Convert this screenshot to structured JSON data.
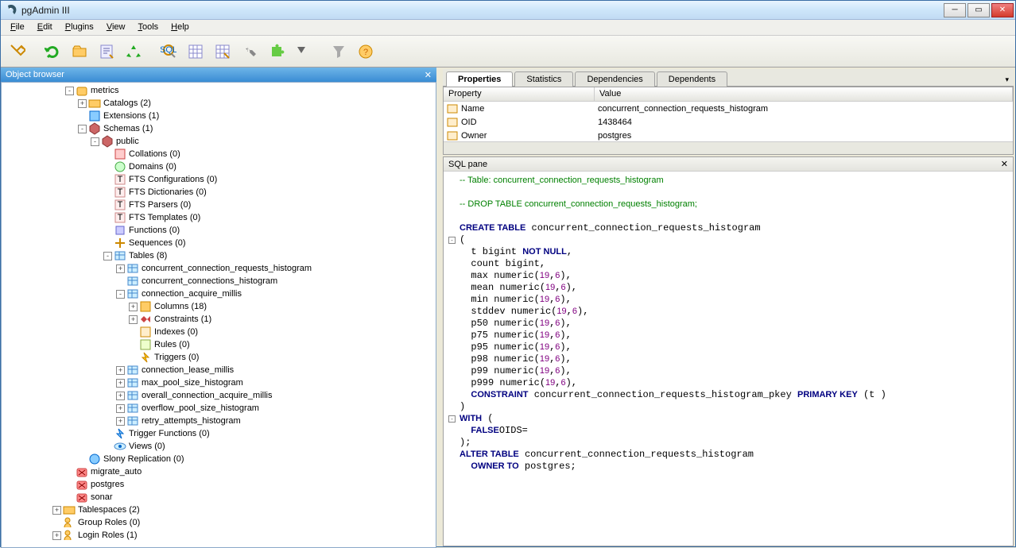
{
  "window": {
    "title": "pgAdmin III"
  },
  "menus": [
    "File",
    "Edit",
    "Plugins",
    "View",
    "Tools",
    "Help"
  ],
  "toolbar_icons": [
    "plug",
    "refresh",
    "open",
    "script",
    "recycle",
    "sql",
    "grid",
    "grid-filter",
    "wrench",
    "puzzle",
    "dropdown",
    "funnel",
    "help"
  ],
  "object_browser": {
    "title": "Object browser",
    "nodes": [
      {
        "indent": 5,
        "exp": "-",
        "icon": "db",
        "label": "metrics"
      },
      {
        "indent": 6,
        "exp": "+",
        "icon": "folder",
        "label": "Catalogs (2)"
      },
      {
        "indent": 6,
        "exp": "",
        "icon": "ext",
        "label": "Extensions (1)"
      },
      {
        "indent": 6,
        "exp": "-",
        "icon": "schema",
        "label": "Schemas (1)"
      },
      {
        "indent": 7,
        "exp": "-",
        "icon": "schema2",
        "label": "public"
      },
      {
        "indent": 8,
        "exp": "",
        "icon": "coll",
        "label": "Collations (0)"
      },
      {
        "indent": 8,
        "exp": "",
        "icon": "dom",
        "label": "Domains (0)"
      },
      {
        "indent": 8,
        "exp": "",
        "icon": "fts",
        "label": "FTS Configurations (0)"
      },
      {
        "indent": 8,
        "exp": "",
        "icon": "fts",
        "label": "FTS Dictionaries (0)"
      },
      {
        "indent": 8,
        "exp": "",
        "icon": "fts",
        "label": "FTS Parsers (0)"
      },
      {
        "indent": 8,
        "exp": "",
        "icon": "fts",
        "label": "FTS Templates (0)"
      },
      {
        "indent": 8,
        "exp": "",
        "icon": "func",
        "label": "Functions (0)"
      },
      {
        "indent": 8,
        "exp": "",
        "icon": "seq",
        "label": "Sequences (0)"
      },
      {
        "indent": 8,
        "exp": "-",
        "icon": "tables",
        "label": "Tables (8)"
      },
      {
        "indent": 9,
        "exp": "+",
        "icon": "table",
        "label": "concurrent_connection_requests_histogram"
      },
      {
        "indent": 9,
        "exp": "",
        "icon": "table",
        "label": "concurrent_connections_histogram"
      },
      {
        "indent": 9,
        "exp": "-",
        "icon": "table",
        "label": "connection_acquire_millis"
      },
      {
        "indent": 10,
        "exp": "+",
        "icon": "cols",
        "label": "Columns (18)"
      },
      {
        "indent": 10,
        "exp": "+",
        "icon": "cons",
        "label": "Constraints (1)"
      },
      {
        "indent": 10,
        "exp": "",
        "icon": "idx",
        "label": "Indexes (0)"
      },
      {
        "indent": 10,
        "exp": "",
        "icon": "rules",
        "label": "Rules (0)"
      },
      {
        "indent": 10,
        "exp": "",
        "icon": "trig",
        "label": "Triggers (0)"
      },
      {
        "indent": 9,
        "exp": "+",
        "icon": "table",
        "label": "connection_lease_millis"
      },
      {
        "indent": 9,
        "exp": "+",
        "icon": "table",
        "label": "max_pool_size_histogram"
      },
      {
        "indent": 9,
        "exp": "+",
        "icon": "table",
        "label": "overall_connection_acquire_millis"
      },
      {
        "indent": 9,
        "exp": "+",
        "icon": "table",
        "label": "overflow_pool_size_histogram"
      },
      {
        "indent": 9,
        "exp": "+",
        "icon": "table",
        "label": "retry_attempts_histogram"
      },
      {
        "indent": 8,
        "exp": "",
        "icon": "trigfn",
        "label": "Trigger Functions (0)"
      },
      {
        "indent": 8,
        "exp": "",
        "icon": "views",
        "label": "Views (0)"
      },
      {
        "indent": 6,
        "exp": "",
        "icon": "slony",
        "label": "Slony Replication (0)"
      },
      {
        "indent": 5,
        "exp": "",
        "icon": "dbred",
        "label": "migrate_auto"
      },
      {
        "indent": 5,
        "exp": "",
        "icon": "dbred",
        "label": "postgres"
      },
      {
        "indent": 5,
        "exp": "",
        "icon": "dbred",
        "label": "sonar"
      },
      {
        "indent": 4,
        "exp": "+",
        "icon": "tbs",
        "label": "Tablespaces (2)"
      },
      {
        "indent": 4,
        "exp": "",
        "icon": "roles",
        "label": "Group Roles (0)"
      },
      {
        "indent": 4,
        "exp": "+",
        "icon": "roles",
        "label": "Login Roles (1)"
      }
    ]
  },
  "tabs": [
    "Properties",
    "Statistics",
    "Dependencies",
    "Dependents"
  ],
  "props_header": {
    "col1": "Property",
    "col2": "Value"
  },
  "props": [
    {
      "k": "Name",
      "v": "concurrent_connection_requests_histogram"
    },
    {
      "k": "OID",
      "v": "1438464"
    },
    {
      "k": "Owner",
      "v": "postgres"
    }
  ],
  "sql_pane": {
    "title": "SQL pane",
    "lines": [
      {
        "cls": "cm",
        "text": "-- Table: concurrent_connection_requests_histogram"
      },
      {
        "cls": "",
        "text": ""
      },
      {
        "cls": "cm",
        "text": "-- DROP TABLE concurrent_connection_requests_histogram;"
      },
      {
        "cls": "",
        "text": ""
      },
      {
        "type": "kw-start",
        "kw": "CREATE TABLE",
        "rest": " concurrent_connection_requests_histogram"
      },
      {
        "fold": "-",
        "text": "("
      },
      {
        "indent": true,
        "col": "t",
        "typ": " bigint ",
        "kw": "NOT NULL",
        "tail": ","
      },
      {
        "indent": true,
        "col": "count",
        "typ": " bigint,",
        "tail": ""
      },
      {
        "indent": true,
        "col": "max",
        "typ": " numeric(",
        "n1": "19",
        "n2": "6",
        "tail": "),"
      },
      {
        "indent": true,
        "col": "mean",
        "typ": " numeric(",
        "n1": "19",
        "n2": "6",
        "tail": "),"
      },
      {
        "indent": true,
        "col": "min",
        "typ": " numeric(",
        "n1": "19",
        "n2": "6",
        "tail": "),"
      },
      {
        "indent": true,
        "col": "stddev",
        "typ": " numeric(",
        "n1": "19",
        "n2": "6",
        "tail": "),"
      },
      {
        "indent": true,
        "col": "p50",
        "typ": " numeric(",
        "n1": "19",
        "n2": "6",
        "tail": "),"
      },
      {
        "indent": true,
        "col": "p75",
        "typ": " numeric(",
        "n1": "19",
        "n2": "6",
        "tail": "),"
      },
      {
        "indent": true,
        "col": "p95",
        "typ": " numeric(",
        "n1": "19",
        "n2": "6",
        "tail": "),"
      },
      {
        "indent": true,
        "col": "p98",
        "typ": " numeric(",
        "n1": "19",
        "n2": "6",
        "tail": "),"
      },
      {
        "indent": true,
        "col": "p99",
        "typ": " numeric(",
        "n1": "19",
        "n2": "6",
        "tail": "),"
      },
      {
        "indent": true,
        "col": "p999",
        "typ": " numeric(",
        "n1": "19",
        "n2": "6",
        "tail": "),"
      },
      {
        "indent": true,
        "kw": "CONSTRAINT",
        "plain": " concurrent_connection_requests_histogram_pkey ",
        "kw2": "PRIMARY KEY",
        "tail": " (t )"
      },
      {
        "text": ")"
      },
      {
        "fold": "-",
        "kw": "WITH",
        "text": " ("
      },
      {
        "indent": true,
        "plain": "OIDS=",
        "kw": "FALSE"
      },
      {
        "text": ");"
      },
      {
        "kw": "ALTER TABLE",
        "plain": " concurrent_connection_requests_histogram"
      },
      {
        "indent": true,
        "kw": "OWNER TO",
        "plain": " postgres;"
      }
    ]
  }
}
